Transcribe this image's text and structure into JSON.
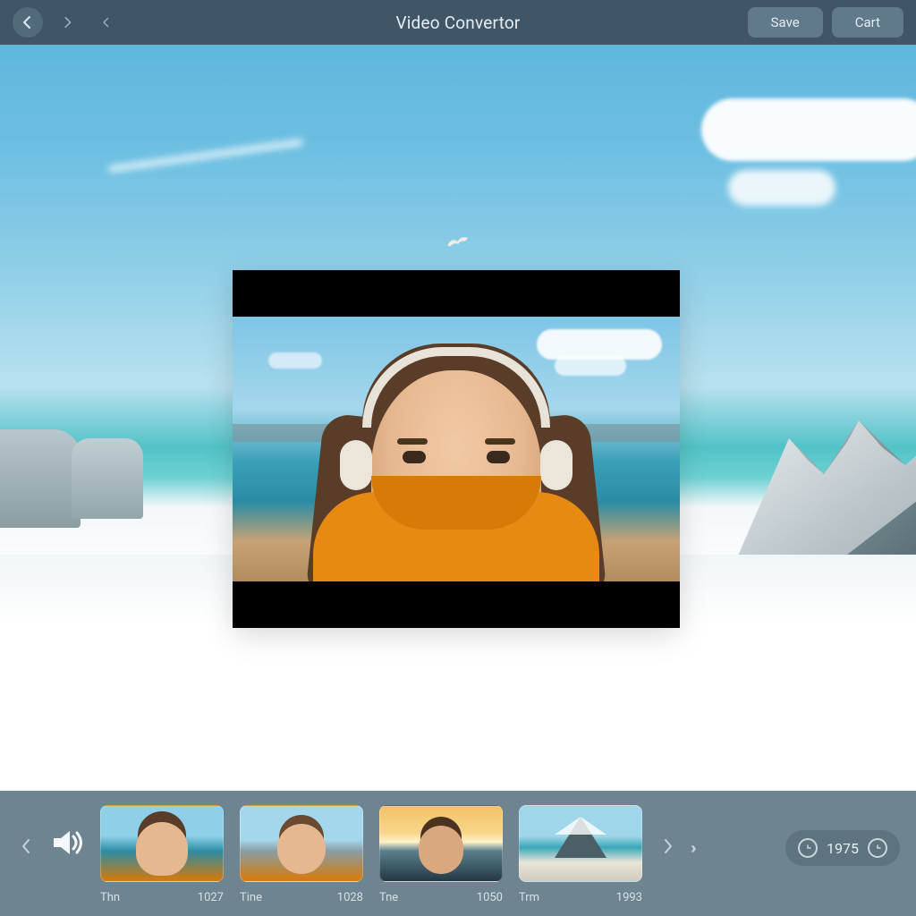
{
  "header": {
    "title": "Video Convertor",
    "save_label": "Save",
    "cart_label": "Cart"
  },
  "footer": {
    "timer_value": "1975",
    "thumbs": [
      {
        "label": "Thn",
        "code": "1027"
      },
      {
        "label": "Tine",
        "code": "1028"
      },
      {
        "label": "Tne",
        "code": "1050"
      },
      {
        "label": "Trm",
        "code": "1993"
      }
    ]
  }
}
